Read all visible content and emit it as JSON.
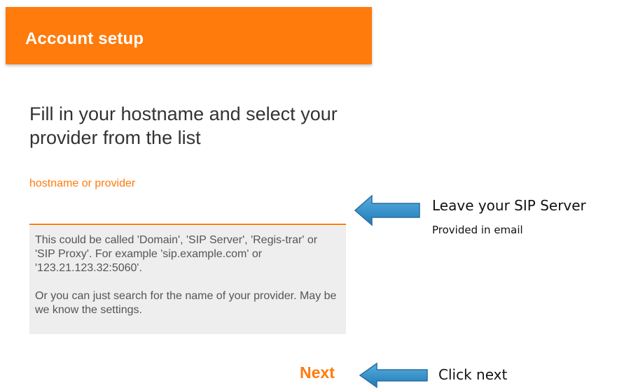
{
  "header": {
    "title": "Account setup"
  },
  "main": {
    "heading": "Fill in your hostname and select your provider from the list",
    "field": {
      "label": "hostname or provider",
      "value": "",
      "placeholder": ""
    },
    "help": {
      "paragraph1": "This could be called 'Domain', 'SIP Server', 'Regis-trar' or 'SIP Proxy'. For example 'sip.example.com' or '123.21.123.32:5060'.",
      "paragraph2": "Or you can just search for the name of your provider. May be we know the settings."
    },
    "next_label": "Next"
  },
  "annotations": {
    "server_main": "Leave your SIP Server",
    "server_sub": "Provided in email",
    "next_hint": "Click next"
  },
  "colors": {
    "accent": "#ff7b0c",
    "arrow": "#2e8fcc"
  },
  "icons": {
    "annotation_arrow": "arrow-left-icon"
  }
}
